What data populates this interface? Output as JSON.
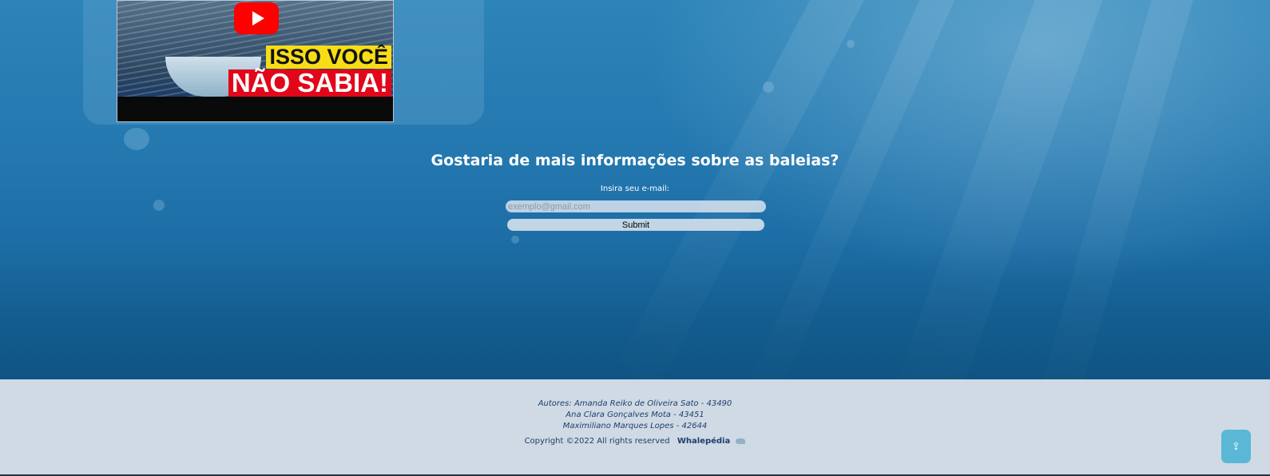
{
  "video": {
    "play_icon": "youtube-play-icon",
    "caption_line1": "ISSO VOCÊ",
    "caption_line2": "NÃO SABIA!"
  },
  "newsletter": {
    "title": "Gostaria de mais informações sobre as baleias?",
    "label": "Insira seu e-mail:",
    "email_placeholder": "exemplo@gmail.com",
    "email_value": "",
    "submit_label": "Submit"
  },
  "footer": {
    "authors": [
      "Autores: Amanda Reiko de Oliveira Sato - 43490",
      "Ana Clara Gonçalves Mota - 43451",
      "Maximiliano Marques Lopes - 42644"
    ],
    "copyright": "Copyright ©2022 All rights reserved",
    "brand": "Whalepédia",
    "brand_icon": "whale-icon",
    "back_to_top_icon": "arrow-up-icon",
    "back_to_top_symbol": "⇪"
  },
  "colors": {
    "ocean": "#1d6ea6",
    "footer_bg": "#cfdae4",
    "footer_text": "#1f3e6e",
    "back_to_top": "#5ab8d6",
    "caption_yellow": "#f6dd16",
    "caption_red": "#e2061b"
  }
}
